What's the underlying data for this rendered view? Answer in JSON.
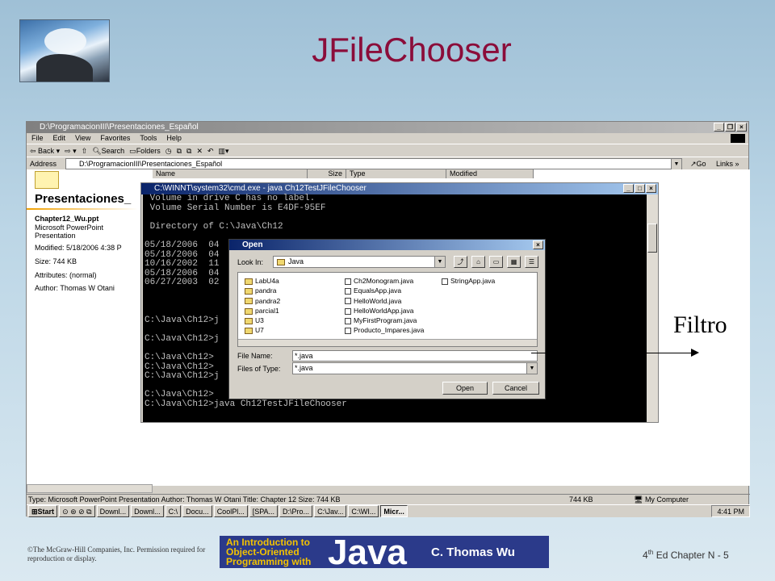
{
  "slide": {
    "title": "JFileChooser",
    "annotation": "Filtro",
    "footer_left": "©The McGraw-Hill Companies, Inc. Permission required for reproduction or display.",
    "footer_right_prefix": "4",
    "footer_right_sup": "th",
    "footer_right_suffix": " Ed Chapter N - 5",
    "book_line1": "An Introduction to",
    "book_line2": "Object-Oriented",
    "book_line3": "Programming with",
    "book_java": "Java",
    "book_author": "C. Thomas Wu"
  },
  "explorer": {
    "title": "D:\\ProgramacionIII\\Presentaciones_Español",
    "menu": [
      "File",
      "Edit",
      "View",
      "Favorites",
      "Tools",
      "Help"
    ],
    "toolbar": {
      "back": "Back",
      "search": "Search",
      "folders": "Folders"
    },
    "address_label": "Address",
    "address_value": "D:\\ProgramacionIII\\Presentaciones_Español",
    "go": "Go",
    "links": "Links",
    "columns": [
      "Name",
      "Size",
      "Type",
      "Modified"
    ],
    "left_pane": {
      "heading": "Presentaciones_",
      "file_name": "Chapter12_Wu.ppt",
      "file_type": "Microsoft PowerPoint Presentation",
      "modified": "Modified: 5/18/2006 4:38 P",
      "size": "Size: 744 KB",
      "attributes": "Attributes: (normal)",
      "author": "Author: Thomas W Otani"
    },
    "status_text": "Type: Microsoft PowerPoint Presentation Author: Thomas W Otani Title: Chapter 12 Size: 744 KB",
    "status_size": "744 KB",
    "status_zone": "My Computer"
  },
  "taskbar": {
    "start": "Start",
    "tasks": [
      "Downl...",
      "Downl...",
      "C:\\",
      "Docu...",
      "CoolPl...",
      "[SPA...",
      "D:\\Pro...",
      "C:\\Jav...",
      "C:\\WI...",
      "Micr..."
    ],
    "active_index": 9,
    "clock": "4:41 PM"
  },
  "cmd": {
    "title": "C:\\WINNT\\system32\\cmd.exe - java Ch12TestJFileChooser",
    "lines": [
      " Volume in drive C has no label.",
      " Volume Serial Number is E4DF-95EF",
      "",
      " Directory of C:\\Java\\Ch12",
      "",
      "05/18/2006  04",
      "05/18/2006  04",
      "10/16/2002  11",
      "05/18/2006  04",
      "06/27/2003  02",
      "",
      "",
      "",
      "C:\\Java\\Ch12>j",
      "",
      "C:\\Java\\Ch12>j",
      "",
      "C:\\Java\\Ch12>",
      "C:\\Java\\Ch12>",
      "C:\\Java\\Ch12>j",
      "",
      "C:\\Java\\Ch12>",
      "C:\\Java\\Ch12>java Ch12TestJFileChooser"
    ]
  },
  "dialog": {
    "title": "Open",
    "look_in_label": "Look In:",
    "look_in_value": "Java",
    "files_col1": [
      {
        "name": "LabU4a",
        "kind": "folder"
      },
      {
        "name": "pandra",
        "kind": "folder"
      },
      {
        "name": "pandra2",
        "kind": "folder"
      },
      {
        "name": "parcial1",
        "kind": "folder"
      },
      {
        "name": "U3",
        "kind": "folder"
      },
      {
        "name": "U7",
        "kind": "folder"
      }
    ],
    "files_col2": [
      {
        "name": "Ch2Monogram.java",
        "kind": "file"
      },
      {
        "name": "EqualsApp.java",
        "kind": "file"
      },
      {
        "name": "HelloWorld.java",
        "kind": "file"
      },
      {
        "name": "HelloWorldApp.java",
        "kind": "file"
      },
      {
        "name": "MyFirstProgram.java",
        "kind": "file"
      },
      {
        "name": "Producto_Impares.java",
        "kind": "file"
      }
    ],
    "files_col3": [
      {
        "name": "StringApp.java",
        "kind": "file"
      }
    ],
    "file_name_label": "File Name:",
    "file_name_value": "*.java",
    "files_of_type_label": "Files of Type:",
    "files_of_type_value": "*.java",
    "open_button": "Open",
    "cancel_button": "Cancel"
  }
}
